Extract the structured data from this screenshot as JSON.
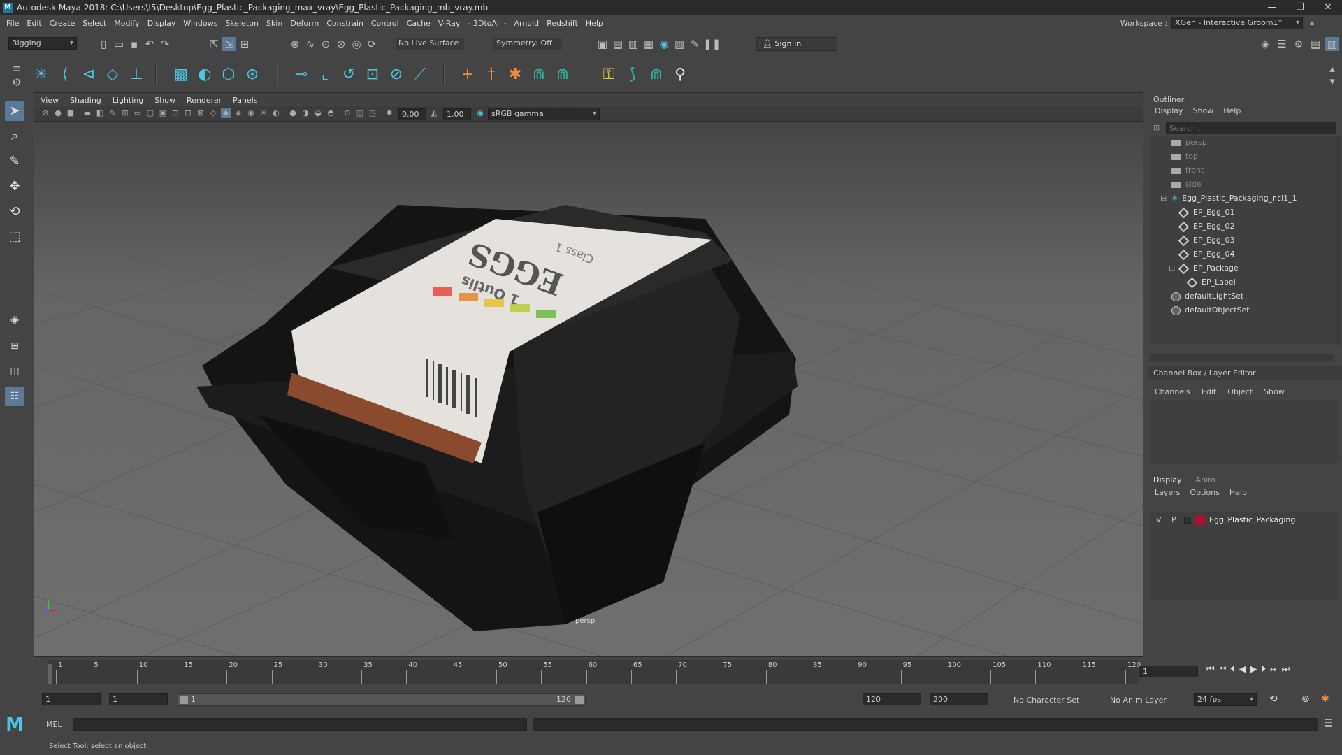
{
  "titlebar": {
    "title": "Autodesk Maya 2018: C:\\Users\\I5\\Desktop\\Egg_Plastic_Packaging_max_vray\\Egg_Plastic_Packaging_mb_vray.mb",
    "controls": [
      "—",
      "❐",
      "✕"
    ]
  },
  "menubar": {
    "items": [
      "File",
      "Edit",
      "Create",
      "Select",
      "Modify",
      "Display",
      "Windows",
      "Skeleton",
      "Skin",
      "Deform",
      "Constrain",
      "Control",
      "Cache",
      "V-Ray",
      "- 3DtoAll -",
      "Arnold",
      "Redshift",
      "Help"
    ],
    "workspace_label": "Workspace :",
    "workspace_value": "XGen - Interactive Groom1*"
  },
  "statusline": {
    "mode": "Rigging",
    "live_surface": "No Live Surface",
    "symmetry": "Symmetry: Off",
    "sign_in": "Sign In"
  },
  "viewport": {
    "menu": [
      "View",
      "Shading",
      "Lighting",
      "Show",
      "Renderer",
      "Panels"
    ],
    "exposure": "0.00",
    "gamma": "1.00",
    "colorspace": "sRGB gamma",
    "camera_label": "persp",
    "label_texts": {
      "eggs": "EGGS",
      "count": "1 Outlis",
      "count2": "Class 1"
    },
    "label_colors": [
      "#e64a3b",
      "#e8852c",
      "#e8c02c",
      "#b6cc3a",
      "#6cbb3c"
    ]
  },
  "outliner": {
    "title": "Outliner",
    "menu": [
      "Display",
      "Show",
      "Help"
    ],
    "search_placeholder": "Search...",
    "rows": [
      {
        "label": "persp",
        "type": "camera",
        "indent": 0,
        "dim": true
      },
      {
        "label": "top",
        "type": "camera",
        "indent": 0,
        "dim": true
      },
      {
        "label": "front",
        "type": "camera",
        "indent": 0,
        "dim": true
      },
      {
        "label": "side",
        "type": "camera",
        "indent": 0,
        "dim": true
      },
      {
        "label": "Egg_Plastic_Packaging_ncl1_1",
        "type": "group",
        "indent": 0,
        "expander": "⊟"
      },
      {
        "label": "EP_Egg_01",
        "type": "mesh",
        "indent": 1
      },
      {
        "label": "EP_Egg_02",
        "type": "mesh",
        "indent": 1
      },
      {
        "label": "EP_Egg_03",
        "type": "mesh",
        "indent": 1
      },
      {
        "label": "EP_Egg_04",
        "type": "mesh",
        "indent": 1
      },
      {
        "label": "EP_Package",
        "type": "mesh",
        "indent": 1,
        "expander": "⊟"
      },
      {
        "label": "EP_Label",
        "type": "mesh",
        "indent": 2
      },
      {
        "label": "defaultLightSet",
        "type": "set",
        "indent": 0
      },
      {
        "label": "defaultObjectSet",
        "type": "set",
        "indent": 0
      }
    ]
  },
  "channelbox": {
    "title": "Channel Box / Layer Editor",
    "menu": [
      "Channels",
      "Edit",
      "Object",
      "Show"
    ]
  },
  "layers": {
    "tabs": [
      "Display",
      "Anim"
    ],
    "menu": [
      "Layers",
      "Options",
      "Help"
    ],
    "layer": {
      "v": "V",
      "p": "P",
      "name": "Egg_Plastic_Packaging",
      "color": "#b0102a"
    }
  },
  "timeline": {
    "ticks": [
      "1",
      "5",
      "10",
      "15",
      "20",
      "25",
      "30",
      "35",
      "40",
      "45",
      "50",
      "55",
      "60",
      "65",
      "70",
      "75",
      "80",
      "85",
      "90",
      "95",
      "100",
      "105",
      "110",
      "115",
      "120"
    ],
    "current_frame": "1"
  },
  "range": {
    "start": "1",
    "playback_start": "1",
    "slider_start": "1",
    "slider_end": "120",
    "playback_end": "120",
    "end": "200",
    "character_set": "No Character Set",
    "anim_layer": "No Anim Layer",
    "fps": "24 fps"
  },
  "cmdline": {
    "label": "MEL"
  },
  "helpline": {
    "text": "Select Tool: select an object"
  }
}
